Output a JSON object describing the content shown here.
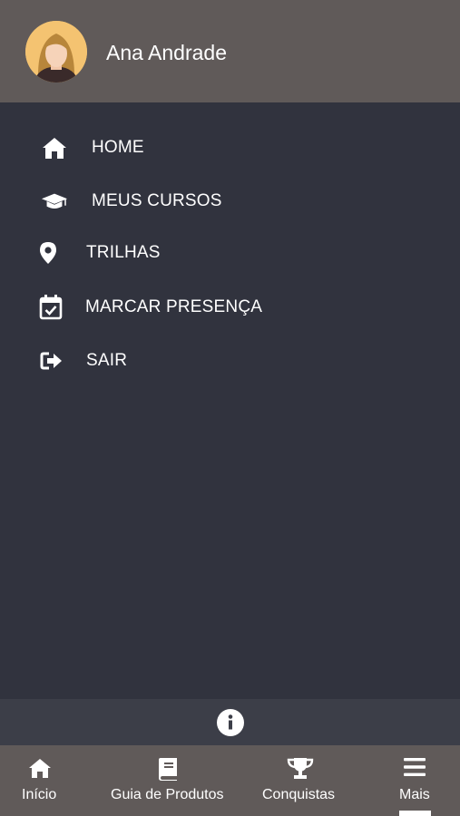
{
  "colors": {
    "header_bg": "#605a59",
    "drawer_bg": "#31333e",
    "info_bar_bg": "#3c3e48",
    "text": "#ffffff",
    "avatar_bg": "#f4c371"
  },
  "user": {
    "name": "Ana Andrade",
    "avatar_icon": "female-user-avatar"
  },
  "menu": {
    "items": [
      {
        "label": "HOME",
        "icon": "home-icon"
      },
      {
        "label": "MEUS CURSOS",
        "icon": "graduation-cap-icon"
      },
      {
        "label": "TRILHAS",
        "icon": "map-marker-icon"
      },
      {
        "label": "MARCAR PRESENÇA",
        "icon": "calendar-check-icon"
      },
      {
        "label": "SAIR",
        "icon": "sign-out-icon"
      }
    ]
  },
  "info": {
    "icon": "info-circle-icon"
  },
  "bottom_nav": {
    "items": [
      {
        "label": "Início",
        "icon": "home-icon"
      },
      {
        "label": "Guia de Produtos",
        "icon": "book-icon"
      },
      {
        "label": "Conquistas",
        "icon": "trophy-icon"
      },
      {
        "label": "Mais",
        "icon": "menu-bars-icon",
        "active": true
      }
    ]
  }
}
